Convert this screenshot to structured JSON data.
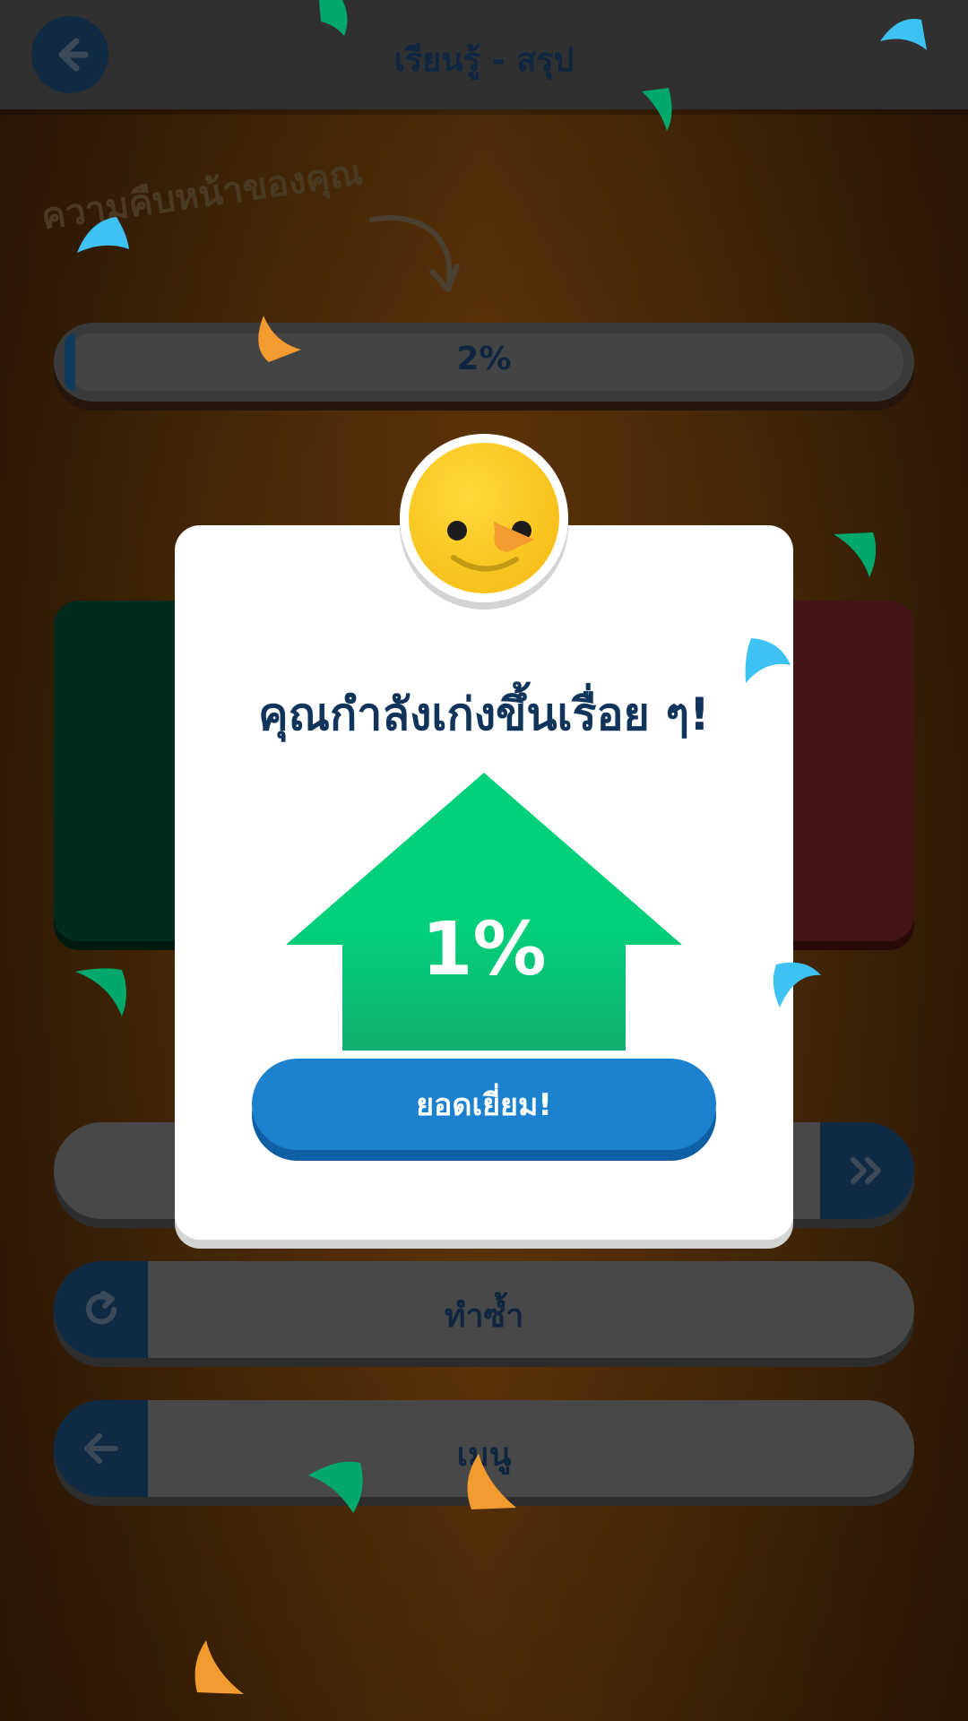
{
  "header": {
    "title": "เรียนรู้ - สรุป",
    "back_icon": "arrow-left-icon"
  },
  "progress": {
    "caption": "ความคืบหน้าของคุณ",
    "percent_label": "2%",
    "value": 0.02
  },
  "buttons": {
    "continue_icon": "double-chevron-right-icon",
    "repeat_label": "ทำซ้ำ",
    "repeat_icon": "refresh-icon",
    "menu_label": "เมนู",
    "menu_icon": "arrow-left-icon"
  },
  "modal": {
    "title": "คุณกำลังเก่งขึ้นเรื่อย ๆ!",
    "improvement_label": "1%",
    "ok_label": "ยอดเยี่ยม!",
    "avatar_icon": "smiling-bird-icon"
  },
  "colors": {
    "accent_blue": "#1c82cf",
    "arrow_green": "#00d07a",
    "title_navy": "#11345a",
    "avatar_yellow": "#ffd83a"
  }
}
